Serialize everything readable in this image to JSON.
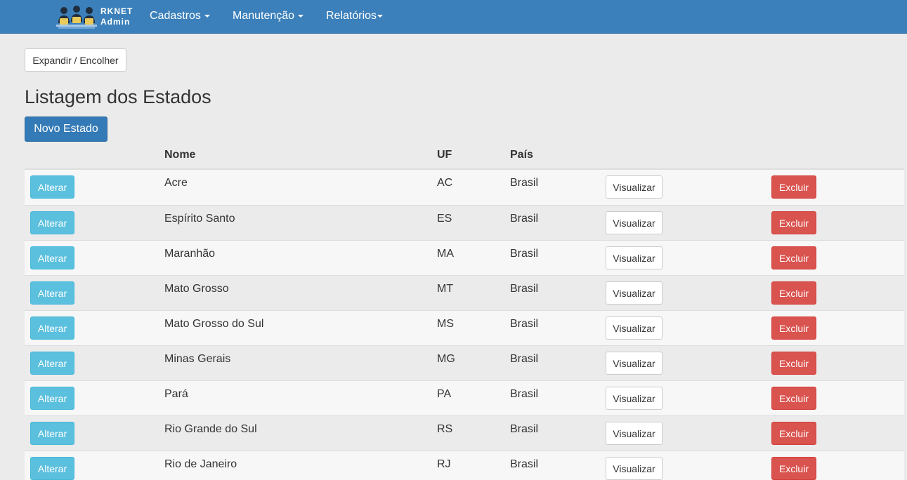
{
  "navbar": {
    "brand_line1": "RKNET",
    "brand_line2": "Admin",
    "menu": [
      {
        "label": "Cadastros"
      },
      {
        "label": "Manutenção"
      },
      {
        "label": "Relatórios"
      }
    ]
  },
  "toolbar": {
    "toggle_label": "Expandir / Encolher"
  },
  "page": {
    "title": "Listagem dos Estados",
    "new_button_label": "Novo Estado"
  },
  "table": {
    "headers": {
      "nome": "Nome",
      "uf": "UF",
      "pais": "País"
    },
    "actions": {
      "edit": "Alterar",
      "view": "Visualizar",
      "delete": "Excluir"
    },
    "rows": [
      {
        "nome": "Acre",
        "uf": "AC",
        "pais": "Brasil"
      },
      {
        "nome": "Espírito Santo",
        "uf": "ES",
        "pais": "Brasil"
      },
      {
        "nome": "Maranhão",
        "uf": "MA",
        "pais": "Brasil"
      },
      {
        "nome": "Mato Grosso",
        "uf": "MT",
        "pais": "Brasil"
      },
      {
        "nome": "Mato Grosso do Sul",
        "uf": "MS",
        "pais": "Brasil"
      },
      {
        "nome": "Minas Gerais",
        "uf": "MG",
        "pais": "Brasil"
      },
      {
        "nome": "Pará",
        "uf": "PA",
        "pais": "Brasil"
      },
      {
        "nome": "Rio Grande do Sul",
        "uf": "RS",
        "pais": "Brasil"
      },
      {
        "nome": "Rio de Janeiro",
        "uf": "RJ",
        "pais": "Brasil"
      }
    ]
  },
  "colors": {
    "navbar": "#3b80ba",
    "primary": "#337ab7",
    "info": "#5bc0de",
    "danger": "#d9534f"
  },
  "icons": {
    "brand_logo": "team-computers-logo",
    "dropdown": "caret-down-icon"
  }
}
